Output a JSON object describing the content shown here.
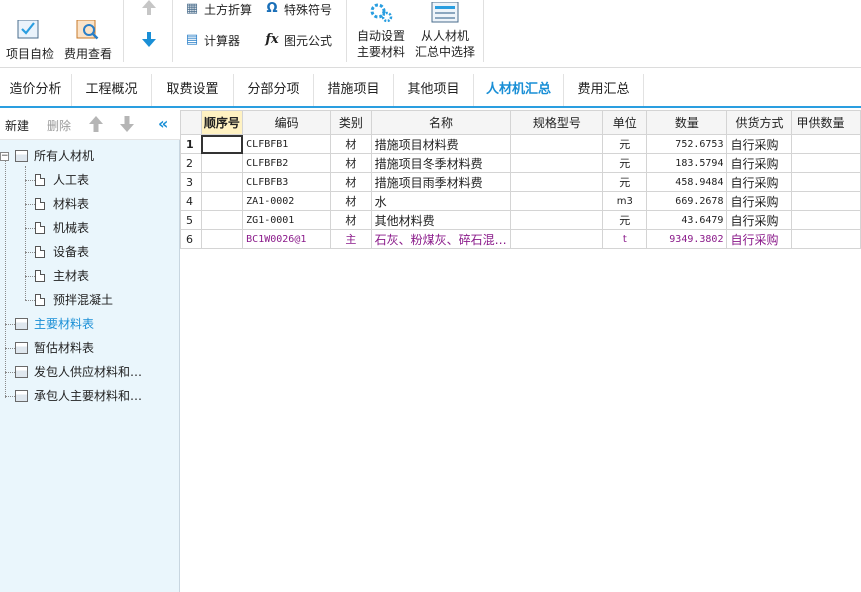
{
  "ribbon": {
    "self_check": "项目自检",
    "cost_view": "费用查看",
    "earth_convert": "土方折算",
    "special_symbol": "特殊符号",
    "calculator": "计算器",
    "element_formula": "图元公式",
    "auto_set_line1": "自动设置",
    "auto_set_line2": "主要材料",
    "select_line1": "从人材机",
    "select_line2": "汇总中选择"
  },
  "tabs": [
    "造价分析",
    "工程概况",
    "取费设置",
    "分部分项",
    "措施项目",
    "其他项目",
    "人材机汇总",
    "费用汇总"
  ],
  "active_tab": "人材机汇总",
  "left_toolbar": {
    "new": "新建",
    "delete": "删除"
  },
  "tree": {
    "root": "所有人材机",
    "children": [
      "人工表",
      "材料表",
      "机械表",
      "设备表",
      "主材表",
      "预拌混凝土"
    ],
    "groups": [
      "主要材料表",
      "暂估材料表",
      "发包人供应材料和…",
      "承包人主要材料和…"
    ]
  },
  "grid": {
    "columns": [
      "顺序号",
      "编码",
      "类别",
      "名称",
      "规格型号",
      "单位",
      "数量",
      "供货方式",
      "甲供数量"
    ],
    "rows": [
      {
        "no": "1",
        "code": "CLFBFB1",
        "type": "材",
        "name": "措施项目材料费",
        "spec": "",
        "unit": "元",
        "qty": "752.6753",
        "supply": "自行采购"
      },
      {
        "no": "2",
        "code": "CLFBFB2",
        "type": "材",
        "name": "措施项目冬季材料费",
        "spec": "",
        "unit": "元",
        "qty": "183.5794",
        "supply": "自行采购"
      },
      {
        "no": "3",
        "code": "CLFBFB3",
        "type": "材",
        "name": "措施项目雨季材料费",
        "spec": "",
        "unit": "元",
        "qty": "458.9484",
        "supply": "自行采购"
      },
      {
        "no": "4",
        "code": "ZA1-0002",
        "type": "材",
        "name": "水",
        "spec": "",
        "unit": "m3",
        "qty": "669.2678",
        "supply": "自行采购"
      },
      {
        "no": "5",
        "code": "ZG1-0001",
        "type": "材",
        "name": "其他材料费",
        "spec": "",
        "unit": "元",
        "qty": "43.6479",
        "supply": "自行采购"
      },
      {
        "no": "6",
        "code": "BC1W0026@1",
        "type": "主",
        "name": "石灰、粉煤灰、碎石混…",
        "spec": "",
        "unit": "t",
        "qty": "9349.3802",
        "supply": "自行采购"
      }
    ]
  }
}
